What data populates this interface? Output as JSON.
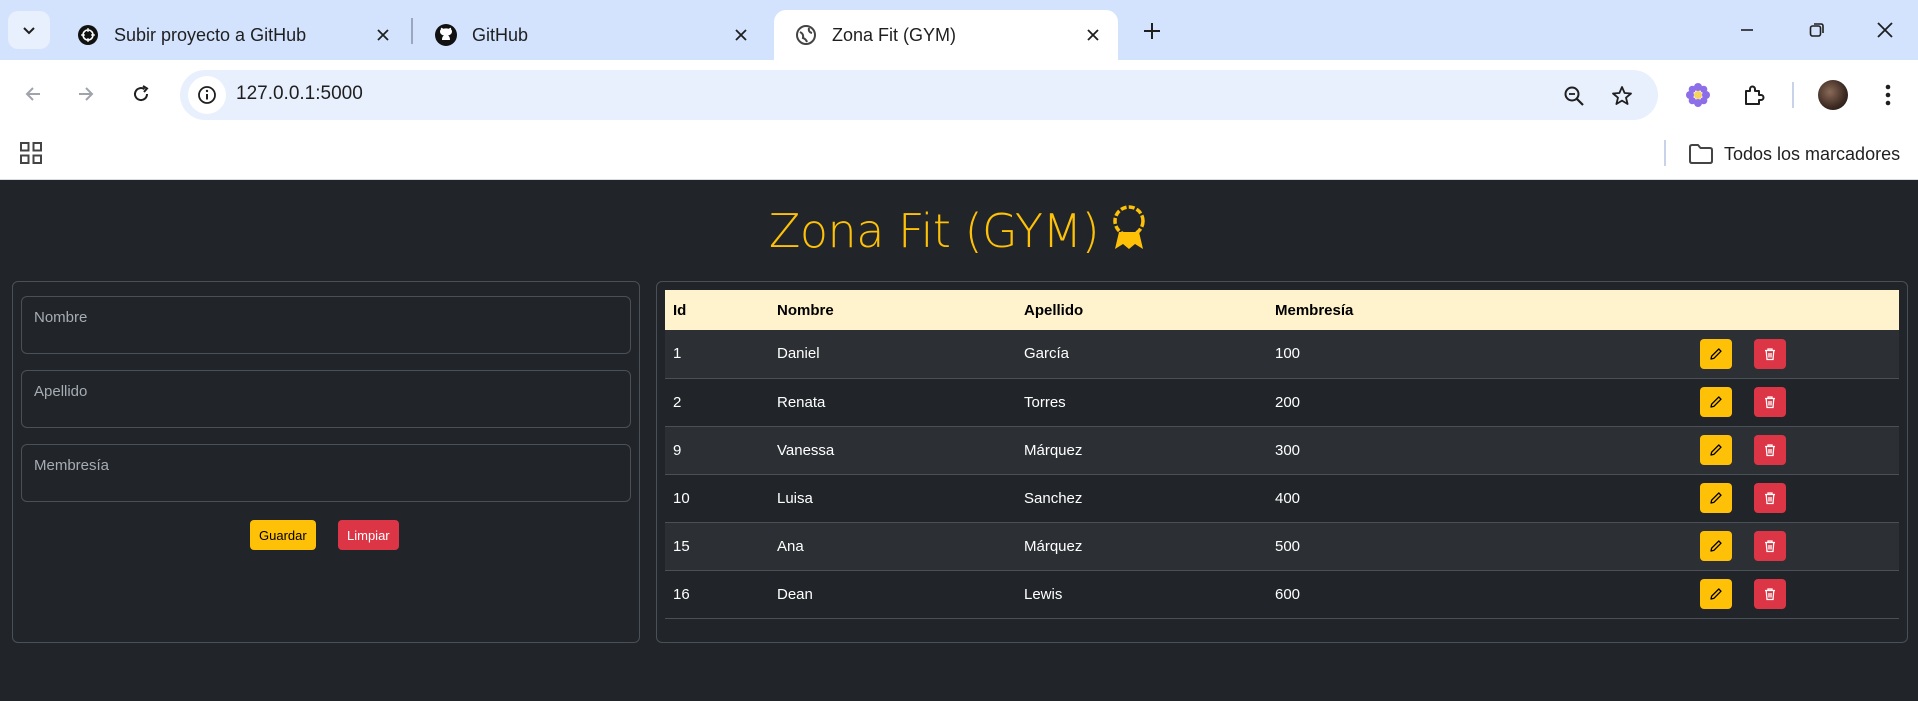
{
  "browser": {
    "tabs": [
      {
        "title": "Subir proyecto a GitHub",
        "icon": "openai-icon"
      },
      {
        "title": "GitHub",
        "icon": "github-icon"
      },
      {
        "title": "Zona Fit (GYM)",
        "icon": "globe-icon",
        "active": true
      }
    ],
    "url": "127.0.0.1:5000",
    "bookmarks": {
      "all_label": "Todos los marcadores"
    }
  },
  "page": {
    "title": "Zona Fit (GYM)",
    "title_icon": "award-icon",
    "accent": "#ffc107",
    "form": {
      "fields": [
        {
          "label": "Nombre",
          "value": ""
        },
        {
          "label": "Apellido",
          "value": ""
        },
        {
          "label": "Membresía",
          "value": ""
        }
      ],
      "save_label": "Guardar",
      "clear_label": "Limpiar"
    },
    "table": {
      "headers": [
        "Id",
        "Nombre",
        "Apellido",
        "Membresía"
      ],
      "rows": [
        {
          "id": "1",
          "nombre": "Daniel",
          "apellido": "García",
          "membresia": "100"
        },
        {
          "id": "2",
          "nombre": "Renata",
          "apellido": "Torres",
          "membresia": "200"
        },
        {
          "id": "9",
          "nombre": "Vanessa",
          "apellido": "Márquez",
          "membresia": "300"
        },
        {
          "id": "10",
          "nombre": "Luisa",
          "apellido": "Sanchez",
          "membresia": "400"
        },
        {
          "id": "15",
          "nombre": "Ana",
          "apellido": "Márquez",
          "membresia": "500"
        },
        {
          "id": "16",
          "nombre": "Dean",
          "apellido": "Lewis",
          "membresia": "600"
        }
      ]
    }
  }
}
